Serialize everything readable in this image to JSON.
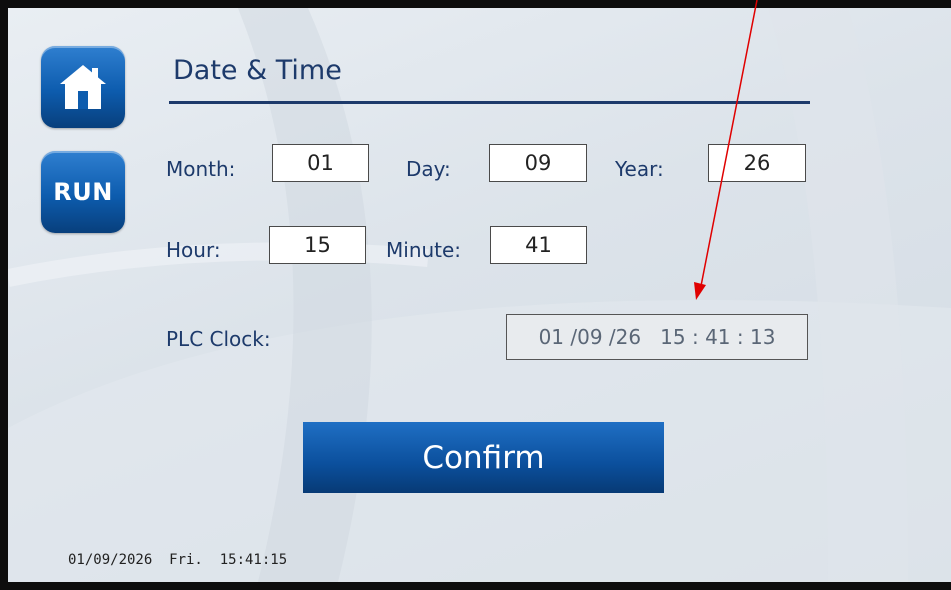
{
  "page": {
    "title": "Date & Time"
  },
  "nav": {
    "home_icon": "home-icon",
    "run_label": "RUN"
  },
  "date_fields": {
    "month_label": "Month:",
    "month_value": "01",
    "day_label": "Day:",
    "day_value": "09",
    "year_label": "Year:",
    "year_value": "26"
  },
  "time_fields": {
    "hour_label": "Hour:",
    "hour_value": "15",
    "minute_label": "Minute:",
    "minute_value": "41"
  },
  "plc_clock": {
    "label": "PLC Clock:",
    "value": "01 /09 /26   15 : 41 : 13"
  },
  "actions": {
    "confirm_label": "Confirm"
  },
  "status_bar": {
    "datetime": "01/09/2026  Fri.  15:41:15"
  },
  "colors": {
    "accent": "#0d5cae",
    "title_text": "#1d3a6b",
    "annotation_arrow": "#e00000"
  }
}
